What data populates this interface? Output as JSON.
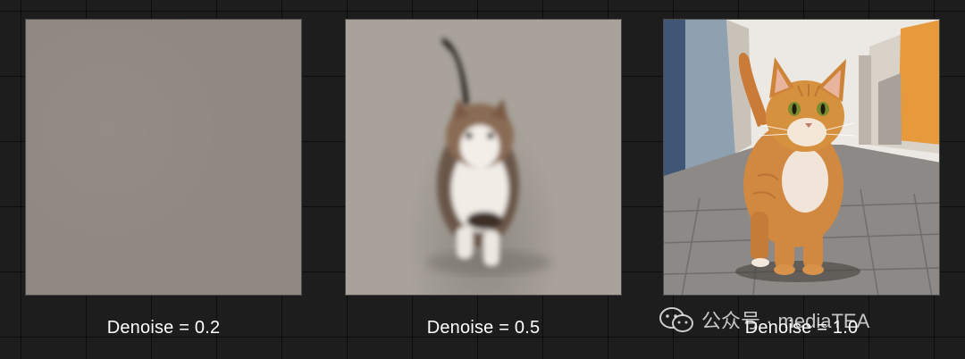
{
  "panels": [
    {
      "caption": "Denoise = 0.2",
      "image": "uniform-noise-gray"
    },
    {
      "caption": "Denoise = 0.5",
      "image": "blurry-cat-walking"
    },
    {
      "caption": "Denoise = 1.0",
      "image": "orange-cat-walking-on-cobblestone-street"
    }
  ],
  "watermark": {
    "text": "公众号 · mediaTEA",
    "icon": "wechat-icon"
  },
  "colors": {
    "background": "#1d1d1d",
    "caption_text": "#ffffff",
    "noise_gray": "#8f8880"
  }
}
